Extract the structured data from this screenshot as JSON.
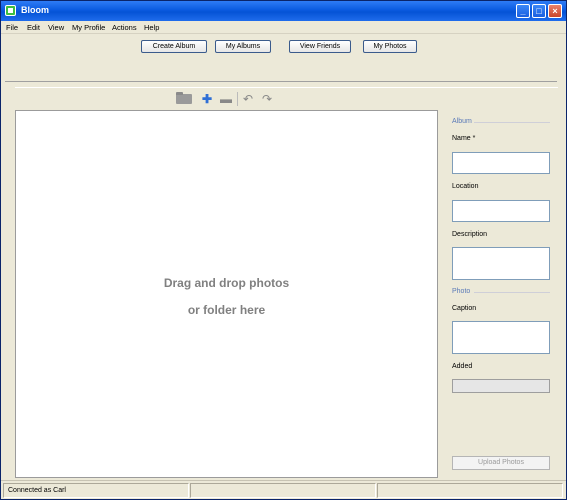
{
  "window": {
    "title": "Bloom",
    "controls": {
      "minimize": "_",
      "maximize": "□",
      "close": "×"
    }
  },
  "menu": [
    "File",
    "Edit",
    "View",
    "My Profile",
    "Actions",
    "Help"
  ],
  "nav_buttons": {
    "create_album": "Create Album",
    "my_albums": "My Albums",
    "view_friends": "View Friends",
    "my_photos": "My Photos"
  },
  "toolbar": {
    "icons": [
      "folder-icon",
      "add-icon",
      "remove-icon",
      "rotate-left-icon",
      "rotate-right-icon"
    ],
    "add_glyph": "✚",
    "remove_glyph": "▬",
    "rotate_left_glyph": "↶",
    "rotate_right_glyph": "↷"
  },
  "dropzone": {
    "line1": "Drag and drop photos",
    "line2": "or folder here"
  },
  "album_panel": {
    "section_title": "Album",
    "name_label": "Name *",
    "location_label": "Location",
    "description_label": "Description",
    "name_value": "",
    "location_value": "",
    "description_value": ""
  },
  "photo_panel": {
    "section_title": "Photo",
    "caption_label": "Caption",
    "added_label": "Added",
    "caption_value": "",
    "added_value": ""
  },
  "upload_button": "Upload Photos",
  "status": {
    "connection": "Connected as Carl"
  },
  "colors": {
    "accent": "#5a7ab8",
    "titlebar": "#0a5ae0",
    "window_bg": "#ece9d8"
  }
}
